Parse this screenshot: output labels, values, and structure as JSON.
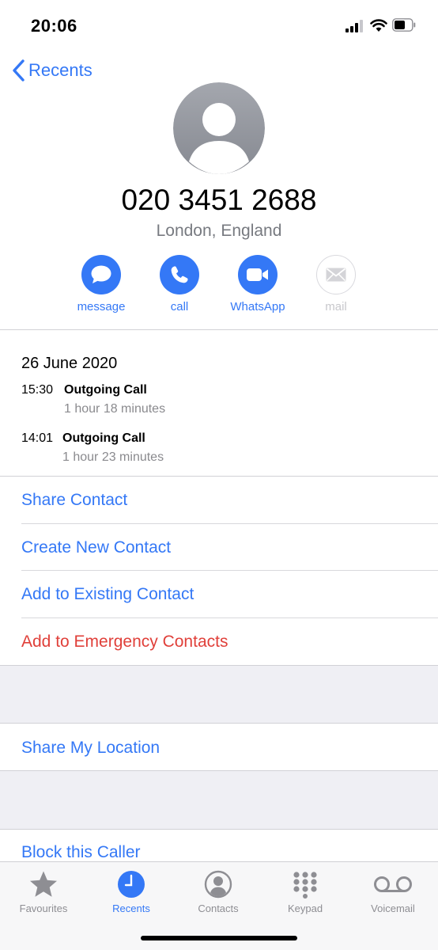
{
  "status_bar": {
    "time": "20:06"
  },
  "nav": {
    "back_label": "Recents"
  },
  "contact": {
    "number": "020 3451 2688",
    "location": "London, England"
  },
  "actions": [
    {
      "label": "message",
      "icon": "message-bubble-icon",
      "enabled": true
    },
    {
      "label": "call",
      "icon": "phone-icon",
      "enabled": true
    },
    {
      "label": "WhatsApp",
      "icon": "video-camera-icon",
      "enabled": true
    },
    {
      "label": "mail",
      "icon": "envelope-icon",
      "enabled": false
    }
  ],
  "history": {
    "date": "26 June 2020",
    "calls": [
      {
        "time": "15:30",
        "type": "Outgoing Call",
        "duration": "1 hour 18 minutes"
      },
      {
        "time": "14:01",
        "type": "Outgoing Call",
        "duration": "1 hour 23 minutes"
      }
    ]
  },
  "list": {
    "share_contact": "Share Contact",
    "create_new_contact": "Create New Contact",
    "add_to_existing": "Add to Existing Contact",
    "add_to_emergency": "Add to Emergency Contacts",
    "share_location": "Share My Location",
    "block_caller": "Block this Caller"
  },
  "tabs": [
    {
      "label": "Favourites",
      "icon": "star-icon",
      "active": false
    },
    {
      "label": "Recents",
      "icon": "clock-icon",
      "active": true
    },
    {
      "label": "Contacts",
      "icon": "person-circle-icon",
      "active": false
    },
    {
      "label": "Keypad",
      "icon": "keypad-icon",
      "active": false
    },
    {
      "label": "Voicemail",
      "icon": "voicemail-icon",
      "active": false
    }
  ],
  "colors": {
    "accent": "#3478f6",
    "destructive": "#e0403a",
    "inactive_tab": "#8e8e93",
    "grouped_background": "#efeff4"
  }
}
